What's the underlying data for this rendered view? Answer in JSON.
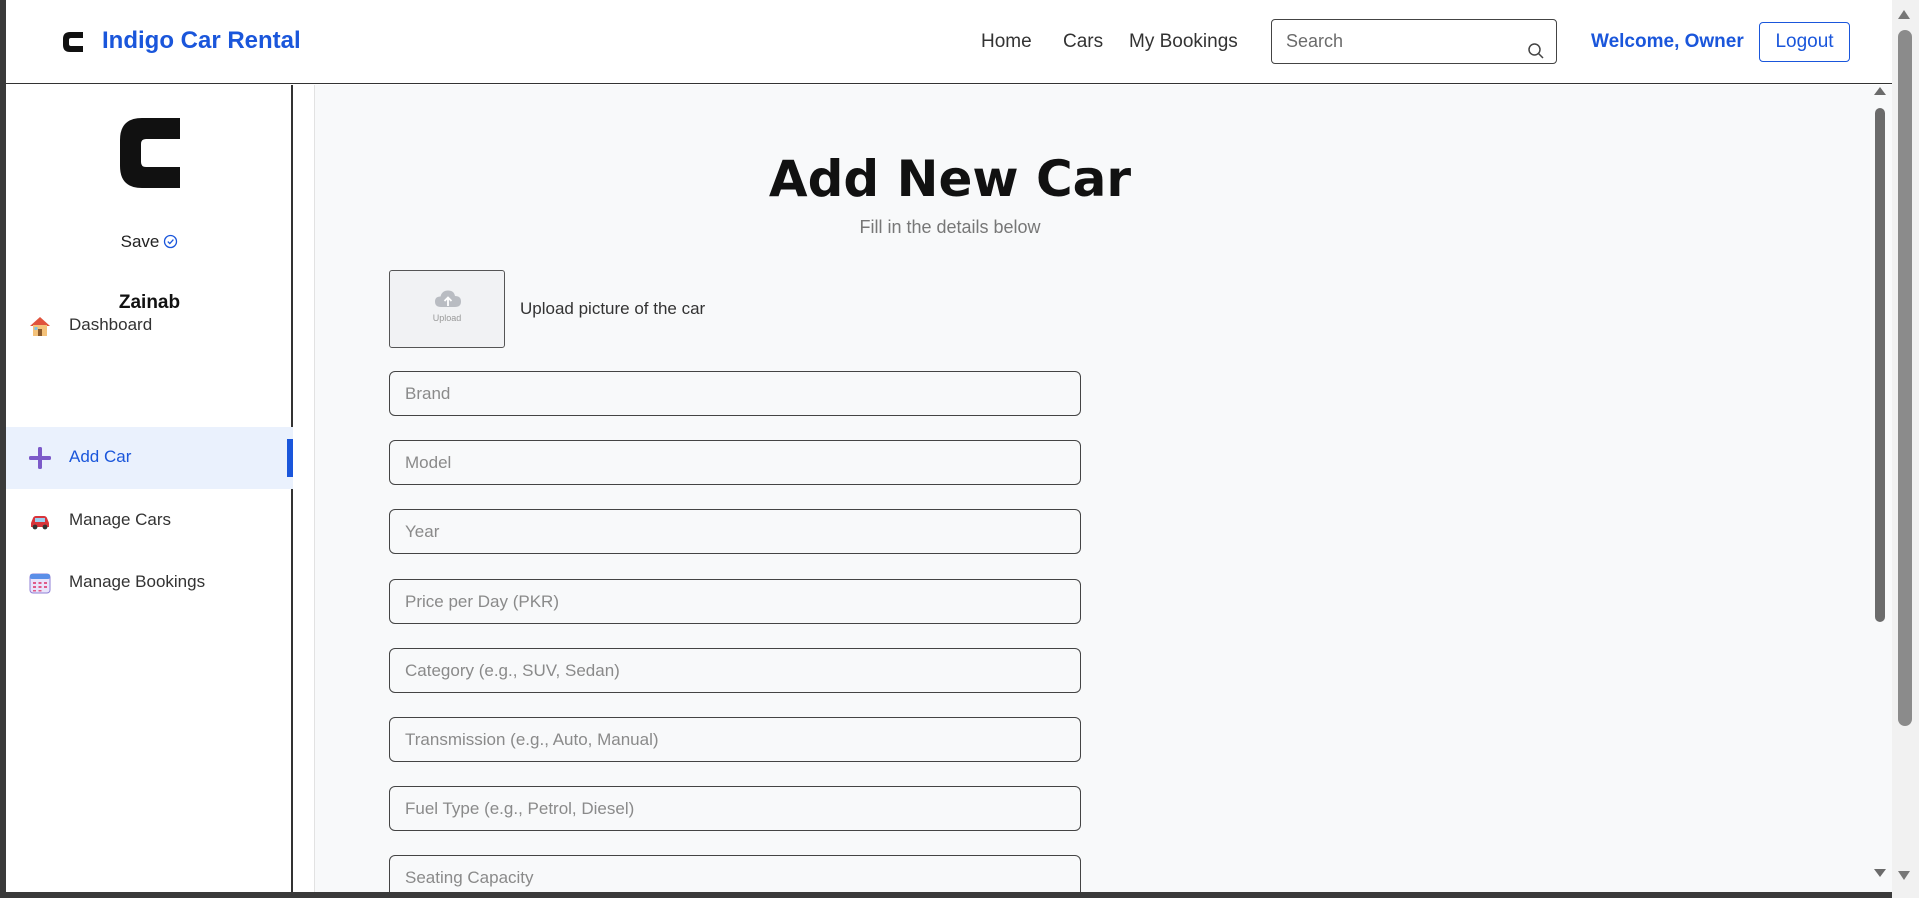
{
  "header": {
    "brand": "Indigo Car Rental",
    "nav": {
      "home": "Home",
      "cars": "Cars",
      "my_bookings": "My Bookings"
    },
    "search_placeholder": "Search",
    "welcome": "Welcome, Owner",
    "logout": "Logout"
  },
  "sidebar": {
    "save_label": "Save",
    "user_name": "Zainab",
    "items": [
      {
        "label": "Dashboard",
        "icon": "house-icon"
      },
      {
        "label": "Add Car",
        "icon": "plus-icon",
        "active": true
      },
      {
        "label": "Manage Cars",
        "icon": "car-icon"
      },
      {
        "label": "Manage Bookings",
        "icon": "calendar-icon"
      }
    ]
  },
  "main": {
    "title": "Add New Car",
    "subtitle": "Fill in the details below",
    "upload": {
      "box_text": "Upload",
      "label": "Upload picture of the car"
    },
    "fields": [
      {
        "placeholder": "Brand"
      },
      {
        "placeholder": "Model"
      },
      {
        "placeholder": "Year"
      },
      {
        "placeholder": "Price per Day (PKR)"
      },
      {
        "placeholder": "Category (e.g., SUV, Sedan)"
      },
      {
        "placeholder": "Transmission (e.g., Auto, Manual)"
      },
      {
        "placeholder": "Fuel Type (e.g., Petrol, Diesel)"
      },
      {
        "placeholder": "Seating Capacity"
      }
    ]
  },
  "colors": {
    "accent": "#1a56db",
    "active_bg": "#eaf1fd",
    "page_bg": "#f8f9fa"
  }
}
